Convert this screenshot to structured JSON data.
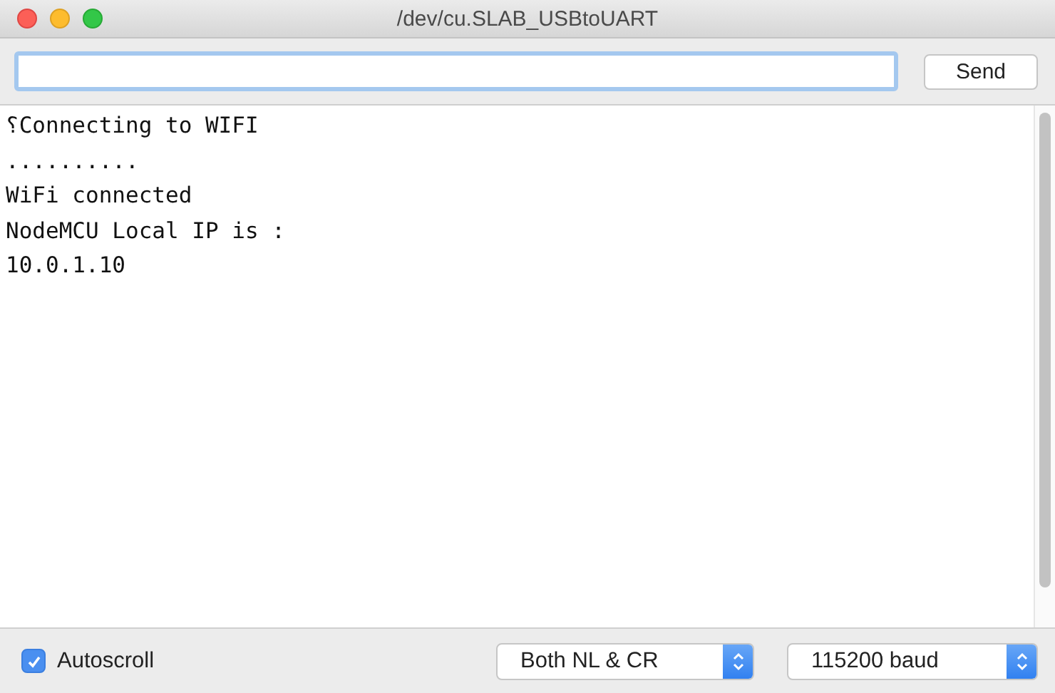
{
  "window": {
    "title": "/dev/cu.SLAB_USBtoUART"
  },
  "send_button": {
    "label": "Send"
  },
  "output": {
    "lines": [
      "⸮Connecting to WIFI",
      "..........",
      "WiFi connected",
      "NodeMCU Local IP is :",
      "10.0.1.10"
    ]
  },
  "autoscroll": {
    "label": "Autoscroll",
    "checked": true
  },
  "line_ending": {
    "value": "Both NL & CR"
  },
  "baud_rate": {
    "value": "115200 baud"
  }
}
